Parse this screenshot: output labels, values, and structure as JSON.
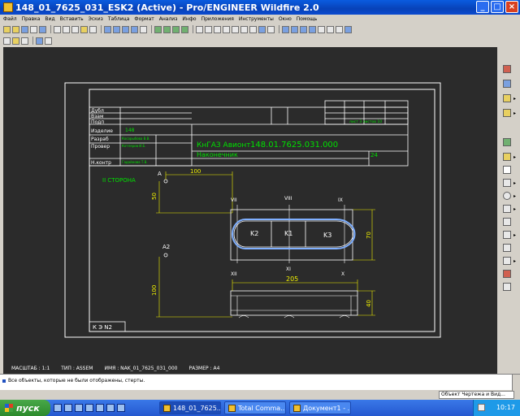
{
  "window": {
    "title": "148_01_7625_031_ESK2 (Active) - Pro/ENGINEER Wildfire 2.0",
    "minimize": "_",
    "maximize": "□",
    "close": "×"
  },
  "menu": [
    "Файл",
    "Правка",
    "Вид",
    "Вставить",
    "Эскиз",
    "Таблица",
    "Формат",
    "Анализ",
    "Инфо",
    "Приложения",
    "Инструменты",
    "Окно",
    "Помощь"
  ],
  "drawing": {
    "frame_rows": [
      "Дубл",
      "Взам",
      "Подп",
      "Изделие",
      "Разраб",
      "Провер",
      "Н.контр"
    ],
    "product_code": "148",
    "developer": "Косорыбова В.В.",
    "checker": "Котляров И.Б.",
    "normcontrol": "Гадайнова Т.В.",
    "sheet_info": "лист 3  листов 10",
    "company": "КнГАЗ Авионт",
    "doc_number": "148.01.7625.031.000",
    "part_name": "Наконечник",
    "sheet_code": "24",
    "side_note": "II СТОРОНА",
    "kz_label": "К Э  N2",
    "point_a": "A",
    "point_a2": "A2",
    "dim_100": "100",
    "dim_50": "50",
    "dim_100v": "100",
    "dim_205": "205",
    "dim_70": "70",
    "dim_40": "40",
    "marks": [
      "VII",
      "VIII",
      "IX",
      "XII",
      "XI",
      "X"
    ],
    "cutouts": [
      "K2",
      "K1",
      "K3"
    ]
  },
  "info": {
    "scale": "МАСШТАБ : 1:1",
    "type": "ТИП : ASSEM",
    "name": "ИМЯ : NAK_01_7625_031_000",
    "size": "РАЗМЕР : A4"
  },
  "message": "Все объекты, которые не были отображены, стерты.",
  "status": {
    "filter": "Объект Чертежа и Вид..."
  },
  "taskbar": {
    "start": "пуск",
    "tasks": [
      "148_01_7625...",
      "Total Comma...",
      "Документ1 - ..."
    ],
    "clock": "10:17"
  },
  "colors": {
    "canvas": "#2b2b2b",
    "geometry": "#ffffff",
    "dimension": "#f0f000",
    "annotation": "#00e000",
    "selection": "#80b0ff"
  }
}
